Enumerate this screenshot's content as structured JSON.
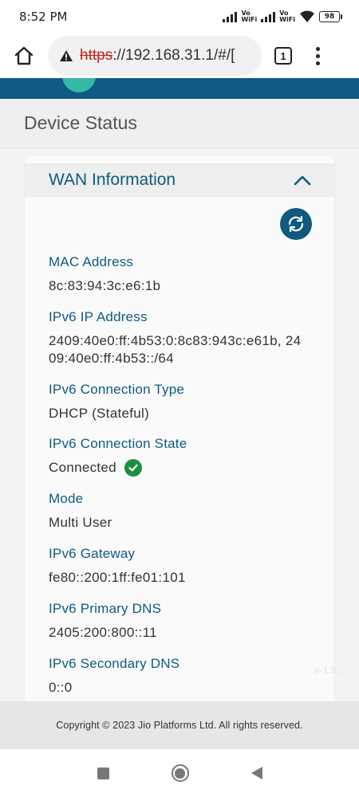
{
  "status_bar": {
    "time": "8:52 PM",
    "vowifi_top": "Vo",
    "vowifi_bottom": "WiFi",
    "battery": "98"
  },
  "browser": {
    "url_scheme": "https",
    "url_rest": "://192.168.31.1/#/[",
    "tab_count": "1"
  },
  "page": {
    "title": "Device Status"
  },
  "wan": {
    "section_title": "WAN Information",
    "fields": [
      {
        "label": "MAC Address",
        "value": "8c:83:94:3c:e6:1b"
      },
      {
        "label": "IPv6 IP Address",
        "value": "2409:40e0:ff:4b53:0:8c83:943c:e61b, 2409:40e0:ff:4b53::/64"
      },
      {
        "label": "IPv6 Connection Type",
        "value": "DHCP (Stateful)"
      },
      {
        "label": "IPv6 Connection State",
        "value": "Connected"
      },
      {
        "label": "Mode",
        "value": "Multi User"
      },
      {
        "label": "IPv6 Gateway",
        "value": "fe80::200:1ff:fe01:101"
      },
      {
        "label": "IPv6 Primary DNS",
        "value": "2405:200:800::11"
      },
      {
        "label": "IPv6 Secondary DNS",
        "value": "0::0"
      }
    ],
    "version": "v-1.8.."
  },
  "footer": {
    "copyright": "Copyright © 2023 Jio Platforms Ltd. All rights reserved."
  },
  "colors": {
    "brand": "#0e5a82",
    "accent": "#34b7a7",
    "success": "#1e8e3e",
    "warning": "#c5221f"
  },
  "icons": [
    "signal-icon",
    "wifi-icon",
    "battery-icon",
    "home-icon",
    "warning-icon",
    "tabs-icon",
    "more-menu-icon",
    "chevron-up-icon",
    "refresh-icon",
    "check-circle-icon",
    "recents-icon",
    "home-nav-icon",
    "back-icon"
  ]
}
